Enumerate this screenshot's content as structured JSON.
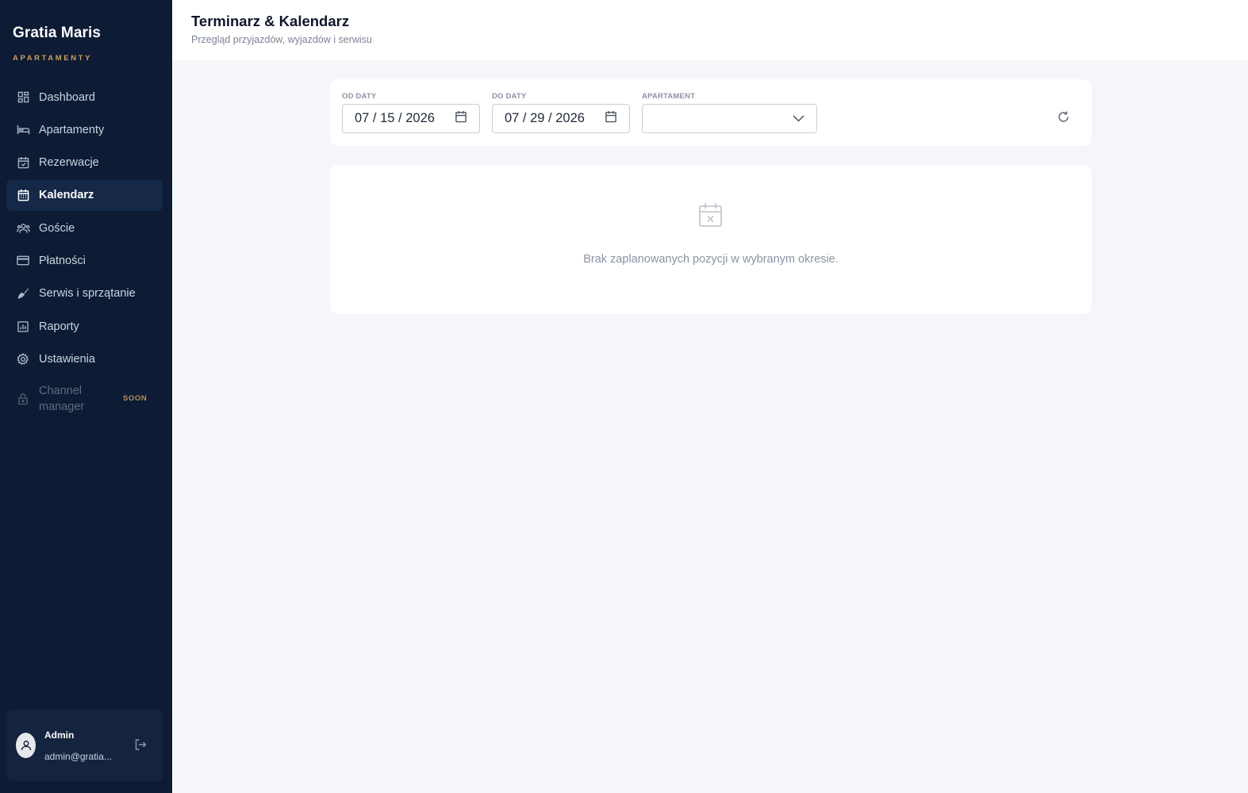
{
  "brand": {
    "name": "Gratia Maris",
    "subtitle": "APARTAMENTY"
  },
  "nav": {
    "items": [
      {
        "label": "Dashboard",
        "icon": "dashboard-icon"
      },
      {
        "label": "Apartamenty",
        "icon": "bed-icon"
      },
      {
        "label": "Rezerwacje",
        "icon": "calendar-check-icon"
      },
      {
        "label": "Kalendarz",
        "icon": "calendar-icon",
        "active": true
      },
      {
        "label": "Goście",
        "icon": "users-icon"
      },
      {
        "label": "Płatności",
        "icon": "credit-card-icon"
      },
      {
        "label": "Serwis i sprzątanie",
        "icon": "broom-icon"
      },
      {
        "label": "Raporty",
        "icon": "bar-chart-icon"
      },
      {
        "label": "Ustawienia",
        "icon": "gear-icon"
      },
      {
        "label": "Channel manager",
        "icon": "lock-icon",
        "badge": "SOON",
        "disabled": true
      }
    ]
  },
  "user": {
    "name": "Admin",
    "email": "admin@gratia..."
  },
  "header": {
    "title": "Terminarz & Kalendarz",
    "subtitle": "Przegląd przyjazdów, wyjazdów i serwisu"
  },
  "filters": {
    "from": {
      "label": "OD DATY",
      "value": "07 / 15 / 2026"
    },
    "to": {
      "label": "DO DATY",
      "value": "07 / 29 / 2026"
    },
    "apartment": {
      "label": "APARTAMENT",
      "value": ""
    }
  },
  "empty": {
    "message": "Brak zaplanowanych pozycji w wybranym okresie."
  },
  "colors": {
    "sidebar": "#0d1b34",
    "accent": "#c9a05c",
    "background": "#f4f6fa"
  }
}
